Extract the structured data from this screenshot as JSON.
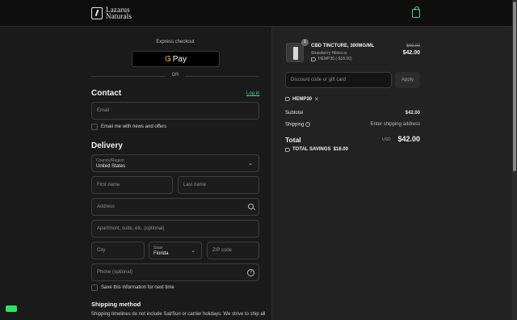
{
  "header": {
    "logo_line1": "Lazarus",
    "logo_line2": "Naturals"
  },
  "express": {
    "label": "Express checkout",
    "gpay_text": "Pay",
    "gpay_g": "G",
    "or": "OR"
  },
  "contact": {
    "heading": "Contact",
    "login_label": "Log in",
    "email_placeholder": "Email",
    "newsletter_label": "Email me with news and offers"
  },
  "delivery": {
    "heading": "Delivery",
    "country_label": "Country/Region",
    "country_value": "United States",
    "first_name_placeholder": "First name",
    "last_name_placeholder": "Last name",
    "address_placeholder": "Address",
    "apartment_placeholder": "Apartment, suite, etc. (optional)",
    "city_placeholder": "City",
    "state_label": "State",
    "state_value": "Florida",
    "zip_placeholder": "ZIP code",
    "phone_placeholder": "Phone (optional)",
    "save_info_label": "Save this information for next time"
  },
  "shipping": {
    "heading": "Shipping method",
    "note": "Shipping timelines do not include Sat/Sun or carrier holidays. We strive to ship all"
  },
  "summary": {
    "product": {
      "quantity": "1",
      "name": "CBD TINCTURE, 300MG/ML",
      "variant": "Strawberry Hibiscus",
      "discount": "HEMP30 (-$18.00)",
      "original_price": "$60.00",
      "price": "$42.00"
    },
    "discount_placeholder": "Discount code or gift card",
    "apply_label": "Apply",
    "applied_code": "HEMP30",
    "subtotal_label": "Subtotal",
    "subtotal_value": "$42.00",
    "shipping_label": "Shipping",
    "shipping_value": "Enter shipping address",
    "total_label": "Total",
    "currency": "USD",
    "total_value": "$42.00",
    "savings_label": "TOTAL SAVINGS",
    "savings_value": "$18.00"
  },
  "colors": {
    "accent": "#4fcf8a",
    "background": "#1a1a1a",
    "summary_background": "#222222"
  }
}
